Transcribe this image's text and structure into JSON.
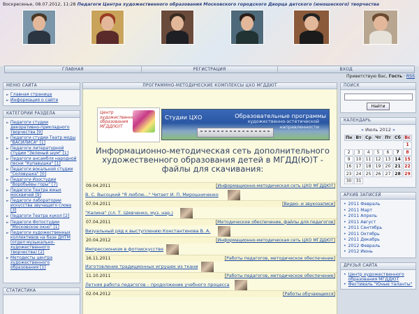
{
  "header": {
    "date": "Воскресенье, 08.07.2012, 11:28",
    "title": "Педагоги Центра художественного образования Московского городского Дворца детского (юношеского) творчества"
  },
  "nav": {
    "items": [
      "ГЛАВНАЯ",
      "РЕГИСТРАЦИЯ",
      "ВХОД"
    ]
  },
  "greeting": {
    "prefix": "Приветствую Вас,",
    "guest": "Гость",
    "sep": "·",
    "rss": "RSS"
  },
  "left": {
    "menu": {
      "title": "МЕНЮ САЙТА",
      "items": [
        "Главная страница",
        "Информация о сайте"
      ]
    },
    "categories": {
      "title": "КАТЕГОРИИ РАЗДЕЛА",
      "items": [
        "Педагоги студии декоративно-прикладного творчества [9]",
        "Педагоги студии Театр моды \"ВАСИЛИСА\" [1]",
        "Педагоги литературной студии \"Зеленый шум\" [1]",
        "Педагоги ансамбля народной песни \"Купавушка\" [1]",
        "Педагоги вокальной студии \"Соловушка\" [0]",
        "Педагоги Изостудии \"Воробьёвы горы\" [7]",
        "Педагоги Театра юных москвичей [9]",
        "Педагоги лаборатории искусства звучащего слова [3]",
        "Педагоги Театра кукол [2]",
        "Педагоги Фотостудии \"Московское окно\" [1]",
        "Педагоги художественных коллективов на базе ДНТМ (отдел музыкально-художественного творчества) [2]",
        "Методисты центра художественного образования [1]"
      ]
    },
    "stats": {
      "title": "СТАТИСТИКА"
    }
  },
  "center": {
    "header": "ПРОГРАММНО-МЕТОДИЧЕСКИЕ КОМПЛЕКСЫ ЦХО МГДДЮТ",
    "logo_text": "Центр художественного образования МГДД(Ю)Т",
    "banner": {
      "left": "Студии ЦХО",
      "right1": "Образовательные программы",
      "right2a": "художественно-эстетической",
      "right2b": "направленности"
    },
    "title": "Информационно-методическая сеть дополнительного художественного образования детей в МГДД(Ю)Т - файлы для скачивания:",
    "posts": [
      {
        "title": "",
        "date": "09.04.2011",
        "cat": "Информационно-методическая сеть ЦХО МГДДЮТ"
      },
      {
        "title": "В. С. Высоцкий \"Я люблю...\" Читает И. П. Мирошниченко",
        "date": "07.04.2011",
        "cat": "Видео- и звукозаписи"
      },
      {
        "title": "\"Калина\" (сл. Т. Шевченко, муз. нар.)",
        "date": "07.04.2011",
        "cat": "Методическое обеспечение, файлы для педагогов"
      },
      {
        "title": "Визуальный ряд к выступлению Константинова В. А.",
        "date": "20.04.2012",
        "cat": "Информационно-методическая сеть ЦХО МГДДЮТ"
      },
      {
        "title": "Импрессионизм в фотоискусстве",
        "date": "16.11.2011",
        "cat": "Работы педагогов, методическое обеспечение"
      },
      {
        "title": "Изготовление традиционных игрушек из ткани",
        "date": "11.10.2011",
        "cat": "Работы педагогов, методическое обеспечение"
      },
      {
        "title": "Летняя работа педагогов – продолжение учебного процесса",
        "date": "02.04.2012",
        "cat": "Работы обучающихся"
      }
    ]
  },
  "right": {
    "search": {
      "title": "ПОИСК",
      "button": "Найти"
    },
    "calendar": {
      "title": "КАЛЕНДАРЬ",
      "prev": "«",
      "month": "Июль 2012",
      "next": "»",
      "weekdays": [
        "Пн",
        "Вт",
        "Ср",
        "Чт",
        "Пт",
        "Сб",
        "Вс"
      ],
      "weeks": [
        [
          "",
          "",
          "",
          "",
          "",
          "",
          "1"
        ],
        [
          "2",
          "3",
          "4",
          "5",
          "6",
          "7",
          "8"
        ],
        [
          "9",
          "10",
          "11",
          "12",
          "13",
          "14",
          "15"
        ],
        [
          "16",
          "17",
          "18",
          "19",
          "20",
          "21",
          "22"
        ],
        [
          "23",
          "24",
          "25",
          "26",
          "27",
          "28",
          "29"
        ],
        [
          "30",
          "31",
          "",
          "",
          "",
          "",
          ""
        ]
      ]
    },
    "archive": {
      "title": "АРХИВ ЗАПИСЕЙ",
      "items": [
        "2011 Февраль",
        "2011 Март",
        "2011 Апрель",
        "2011 Август",
        "2011 Сентябрь",
        "2011 Октябрь",
        "2011 Декабрь",
        "2012 Февраль",
        "2012 Июнь"
      ]
    },
    "friends": {
      "title": "ДРУЗЬЯ САЙТА",
      "items": [
        "Центр художественного образования МГДДЮТ",
        "Фестиваль \"Юные таланты\""
      ]
    }
  },
  "colors": {
    "link": "#1a4aa8",
    "sunday": "#c01a1a",
    "title": "#2f3f63",
    "center_bg": "#fbfadf"
  }
}
